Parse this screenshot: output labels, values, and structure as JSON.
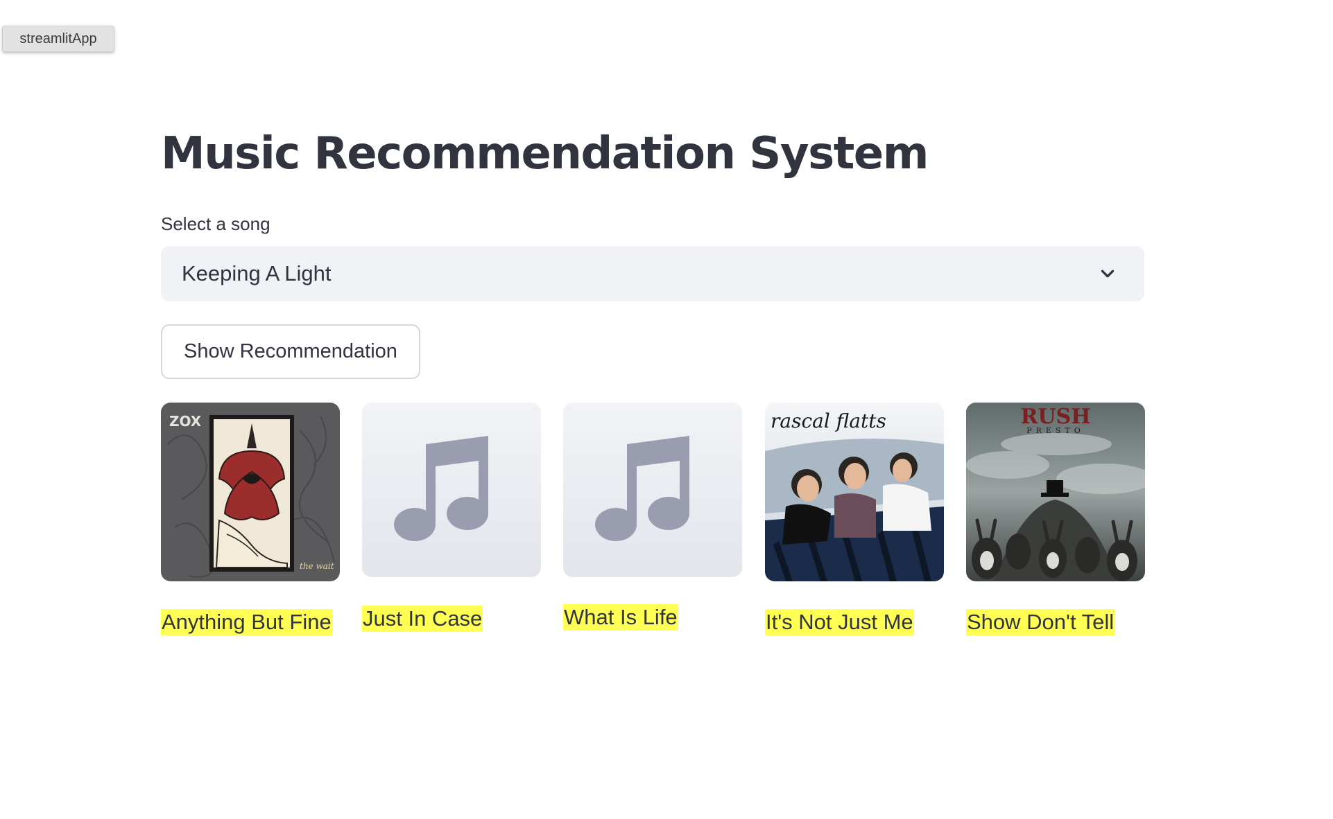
{
  "window": {
    "app_tab_label": "streamlitApp"
  },
  "page": {
    "title": "Music Recommendation System"
  },
  "song_select": {
    "label": "Select a song",
    "selected_value": "Keeping A Light"
  },
  "actions": {
    "show_recommendation_label": "Show Recommendation"
  },
  "recommendations": [
    {
      "title": "Anything But Fine",
      "art": "album-cover-zox-the-wait",
      "art_text": [
        "ZOX",
        "the wait"
      ]
    },
    {
      "title": "Just In Case",
      "art": "music-note-placeholder-icon"
    },
    {
      "title": "What Is Life",
      "art": "music-note-placeholder-icon"
    },
    {
      "title": "It's Not Just Me",
      "art": "album-cover-rascal-flatts",
      "art_text": [
        "rascal flatts"
      ]
    },
    {
      "title": "Show Don't Tell",
      "art": "album-cover-rush-presto",
      "art_text": [
        "RUSH",
        "PRESTO"
      ]
    }
  ],
  "colors": {
    "caption_highlight": "#ffff54",
    "select_background": "#f0f2f6",
    "text": "#31333f"
  }
}
